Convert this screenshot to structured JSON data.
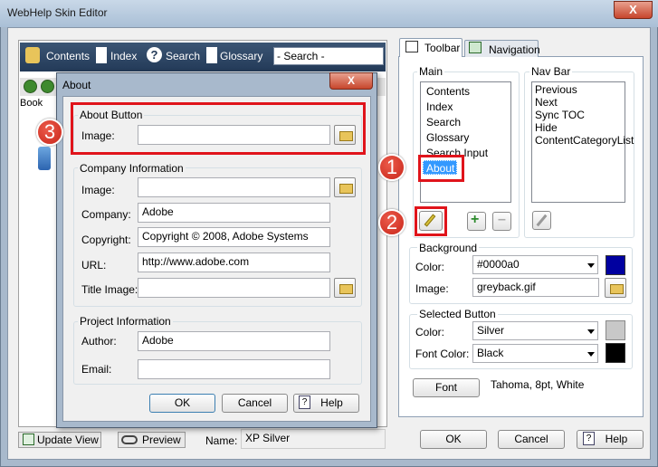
{
  "window": {
    "title": "WebHelp Skin Editor",
    "close": "X"
  },
  "preview": {
    "toolbar": [
      "Contents",
      "Index",
      "Search",
      "Glossary"
    ],
    "search_placeholder": "- Search -",
    "book": "Book"
  },
  "bottom_left": {
    "update": "Update View",
    "preview": "Preview",
    "name_label": "Name:",
    "name_value": "XP Silver"
  },
  "tabs": {
    "toolbar": "Toolbar",
    "navigation": "Navigation"
  },
  "main": {
    "label": "Main",
    "items": [
      "Contents",
      "Index",
      "Search",
      "Glossary",
      "Search Input",
      "About"
    ]
  },
  "navbar": {
    "label": "Nav Bar",
    "items": [
      "Previous",
      "Next",
      "Sync TOC",
      "Hide",
      "ContentCategoryList"
    ]
  },
  "background": {
    "label": "Background",
    "color_label": "Color:",
    "color_value": "#0000a0",
    "image_label": "Image:",
    "image_value": "greyback.gif",
    "swatch": "#0000a0"
  },
  "selected_button": {
    "label": "Selected Button",
    "color_label": "Color:",
    "color_value": "Silver",
    "font_color_label": "Font Color:",
    "font_color_value": "Black",
    "swatch1": "#c8c8c8",
    "swatch2": "#000000"
  },
  "font": {
    "button": "Font",
    "value": "Tahoma, 8pt, White"
  },
  "right_buttons": {
    "ok": "OK",
    "cancel": "Cancel",
    "help": "Help"
  },
  "about": {
    "title": "About",
    "close": "X",
    "about_button": {
      "label": "About Button",
      "image_label": "Image:",
      "image_value": ""
    },
    "company": {
      "label": "Company Information",
      "image_label": "Image:",
      "image_value": "",
      "company_label": "Company:",
      "company_value": "Adobe",
      "copyright_label": "Copyright:",
      "copyright_value": "Copyright © 2008, Adobe Systems",
      "url_label": "URL:",
      "url_value": "http://www.adobe.com",
      "title_image_label": "Title Image:",
      "title_image_value": ""
    },
    "project": {
      "label": "Project Information",
      "author_label": "Author:",
      "author_value": "Adobe",
      "email_label": "Email:",
      "email_value": ""
    },
    "ok": "OK",
    "cancel": "Cancel",
    "help": "Help"
  },
  "badges": [
    "1",
    "2",
    "3"
  ]
}
